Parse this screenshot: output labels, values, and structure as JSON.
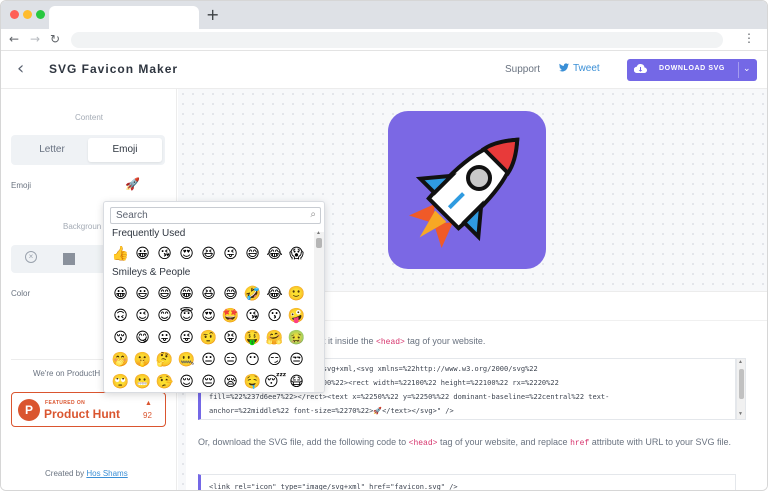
{
  "browser": {
    "new_tab": "+",
    "menu": "⋮"
  },
  "header": {
    "title": "SVG Favicon Maker",
    "support": "Support",
    "tweet": "Tweet",
    "download": "DOWNLOAD SVG"
  },
  "sidebar": {
    "content_label": "Content",
    "tabs": [
      {
        "label": "Letter"
      },
      {
        "label": "Emoji"
      }
    ],
    "emoji_label": "Emoji",
    "selected_emoji": "🚀",
    "background_label": "Backgroun",
    "color_label": "Color",
    "producthunt_text": "We're on ProductH",
    "ph_badge": {
      "featured": "FEATURED ON",
      "name": "Product Hunt",
      "votes": "92"
    },
    "created_by": "Created by",
    "author": "Hos Shams"
  },
  "emoji_picker": {
    "search_placeholder": "Search",
    "sections": [
      {
        "title": "Frequently Used",
        "rows": [
          [
            "👍",
            "😀",
            "😘",
            "😍",
            "😆",
            "😜",
            "😅",
            "😂",
            "😱"
          ]
        ]
      },
      {
        "title": "Smileys & People",
        "rows": [
          [
            "😀",
            "😃",
            "😄",
            "😁",
            "😆",
            "😅",
            "🤣",
            "😂",
            "🙂"
          ],
          [
            "🙃",
            "😉",
            "😊",
            "😇",
            "😍",
            "🤩",
            "😘",
            "😗",
            "🤪"
          ],
          [
            "😚",
            "😋",
            "😛",
            "😜",
            "🤨",
            "😝",
            "🤑",
            "🤗",
            "🤢"
          ],
          [
            "🤭",
            "🤫",
            "🤔",
            "🤐",
            "😐",
            "😑",
            "😶",
            "😏",
            "😒"
          ],
          [
            "🙄",
            "😬",
            "🤥",
            "😌",
            "😔",
            "😪",
            "🤤",
            "😴",
            "😷"
          ]
        ]
      }
    ]
  },
  "main": {
    "instructions_1": "ut it inside the <head> tag of your website.",
    "code_lines": [
      "/svg+xml\" href=\"data:image/svg+xml,<svg xmlns=%22http://www.w3.org/2000/svg%22",
      "256%22 viewBox=%220 0 100 100%22><rect width=%22100%22 height=%22100%22 rx=%2220%22",
      "fill=%22%237d6ee7%22></rect><text x=%2250%%22 y=%2250%%22 dominant-baseline=%22central%22 text-",
      "anchor=%22middle%22 font-size=%2270%22>🚀</text></svg>\" />"
    ],
    "instructions_2_a": "Or, download the SVG file, add the following code to",
    "instructions_2_tag": "<head>",
    "instructions_2_b": "tag of your website, and replace",
    "instructions_2_attr": "href",
    "instructions_2_c": "attribute with URL to your SVG file.",
    "code2": "<link rel=\"icon\" type=\"image/svg+xml\" href=\"favicon.svg\" />"
  },
  "colors": {
    "accent": "#7468e6",
    "preview_bg": "#7b68e4",
    "producthunt": "#da552f"
  }
}
